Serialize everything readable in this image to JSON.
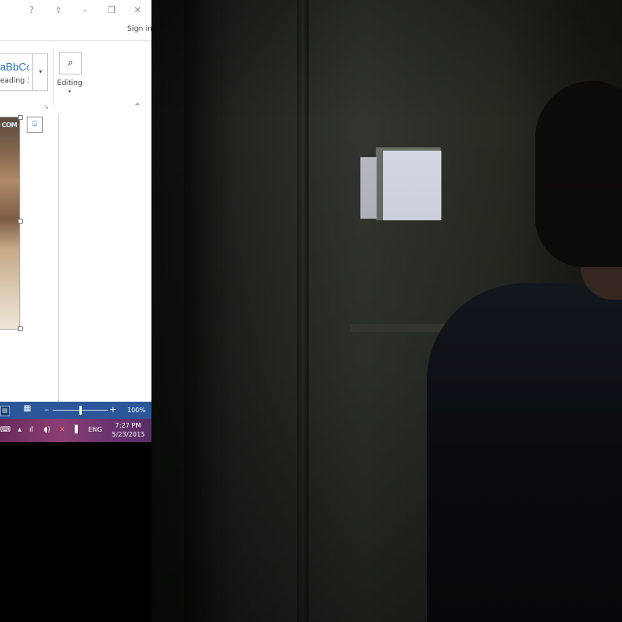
{
  "window": {
    "help_icon": "?",
    "ribbon_display_icon": "⇪",
    "minimize_icon": "–",
    "restore_icon": "❐",
    "close_icon": "✕",
    "sign_in": "Sign in"
  },
  "ribbon": {
    "style_preview": "aBbCc",
    "style_name": "eading 1",
    "styles_more_icon": "▾",
    "editing_icon": "⌕",
    "editing_label": "Editing",
    "editing_arrow": "▾",
    "dialog_launcher_icon": "↘",
    "collapse_icon": "^"
  },
  "document": {
    "image_overlay_text": "COM",
    "layout_options_icon": "⌸"
  },
  "statusbar": {
    "print_layout_icon": "▤",
    "web_layout_icon": "▦",
    "zoom_minus": "–",
    "zoom_plus": "+",
    "zoom_level": "100%",
    "zoom_fraction": 0.5
  },
  "taskbar": {
    "keyboard_icon": "⌨",
    "show_hidden_icon": "▲",
    "signal_icon": "ıl",
    "volume_icon": "◖)",
    "network_icon": "✕",
    "action_icon": "▐",
    "language": "ENG",
    "time": "7:27 PM",
    "date": "5/23/2015"
  },
  "colors": {
    "statusbar": "#2b579a",
    "accent": "#2e74b5"
  }
}
